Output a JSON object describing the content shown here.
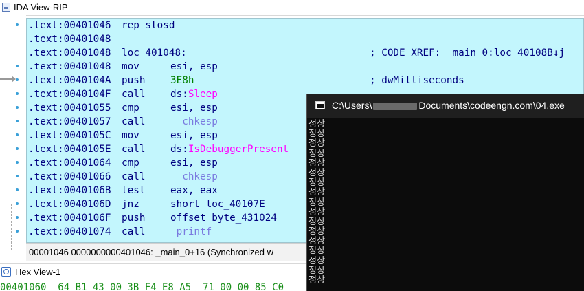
{
  "ida_window": {
    "title": "IDA View-RIP"
  },
  "disassembly": {
    "lines": [
      {
        "addr": ".text:00401046",
        "mnemonic": "rep stosd",
        "operand": "",
        "comment": ""
      },
      {
        "addr": ".text:00401048",
        "mnemonic": "",
        "operand": "",
        "comment": ""
      },
      {
        "addr": ".text:00401048",
        "mnemonic": "loc_401048:",
        "operand": "",
        "comment": "; CODE XREF: _main_0:loc_40108B↓j"
      },
      {
        "addr": ".text:00401048",
        "mnemonic": "mov",
        "operand": "esi, esp",
        "comment": ""
      },
      {
        "addr": ".text:0040104A",
        "mnemonic": "push",
        "operand": "3E8h",
        "comment": "; dwMilliseconds"
      },
      {
        "addr": ".text:0040104F",
        "mnemonic": "call",
        "operand_prefix": "ds:",
        "operand_sym": "Sleep",
        "comment": ""
      },
      {
        "addr": ".text:00401055",
        "mnemonic": "cmp",
        "operand": "esi, esp",
        "comment": ""
      },
      {
        "addr": ".text:00401057",
        "mnemonic": "call",
        "operand_fn": "__chkesp",
        "comment": ""
      },
      {
        "addr": ".text:0040105C",
        "mnemonic": "mov",
        "operand": "esi, esp",
        "comment": ""
      },
      {
        "addr": ".text:0040105E",
        "mnemonic": "call",
        "operand_prefix": "ds:",
        "operand_sym": "IsDebuggerPresent",
        "comment": ""
      },
      {
        "addr": ".text:00401064",
        "mnemonic": "cmp",
        "operand": "esi, esp",
        "comment": ""
      },
      {
        "addr": ".text:00401066",
        "mnemonic": "call",
        "operand_fn": "__chkesp",
        "comment": ""
      },
      {
        "addr": ".text:0040106B",
        "mnemonic": "test",
        "operand": "eax, eax",
        "comment": ""
      },
      {
        "addr": ".text:0040106D",
        "mnemonic": "jnz",
        "operand": "short loc_40107E",
        "comment": ""
      },
      {
        "addr": ".text:0040106F",
        "mnemonic": "push",
        "operand": "offset byte_431024",
        "comment": ""
      },
      {
        "addr": ".text:00401074",
        "mnemonic": "call",
        "operand_fn": "_printf",
        "comment": ""
      }
    ]
  },
  "status_bar": {
    "text": "00001046 0000000000401046: _main_0+16 (Synchronized w"
  },
  "hex_window": {
    "title": "Hex View-1",
    "row_text": "00401060  64 B1 43 00 3B F4 E8 A5  71 00 00 85 C0"
  },
  "console": {
    "title_prefix": "C:\\Users\\",
    "title_suffix": "Documents\\codeengn.com\\04.exe",
    "output_lines": [
      "정상",
      "정상",
      "정상",
      "정상",
      "정상",
      "정상",
      "정상",
      "정상",
      "정상",
      "정상",
      "정상",
      "정상",
      "정상",
      "정상",
      "정상",
      "정상",
      "정상"
    ]
  },
  "colors": {
    "disasm_bg": "#c3f6fd",
    "address": "#000080",
    "imported_symbol": "#ff00ff",
    "function_symbol": "#7a7adf",
    "console_bg": "#0c0c0c"
  }
}
